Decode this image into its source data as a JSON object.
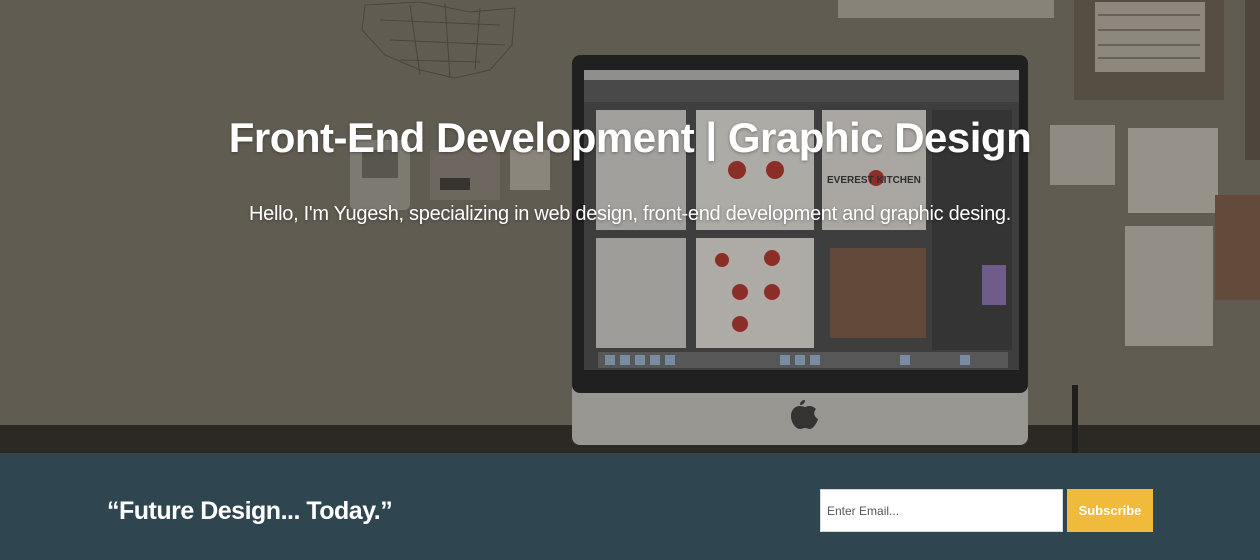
{
  "hero": {
    "title": "Front-End Development | Graphic Design",
    "subtitle": "Hello, I'm Yugesh, specializing in web design, front-end development and graphic desing.",
    "background_image": {
      "description_icon": "desk-with-imac-photo",
      "monitor_brand_text": "EVEREST KITCHEN"
    }
  },
  "cta": {
    "tagline": "“Future Design... Today.”",
    "email_placeholder": "Enter Email...",
    "subscribe_label": "Subscribe"
  },
  "colors": {
    "bar_background": "#2f4550",
    "subscribe_button": "#f0bb3a",
    "text": "#ffffff"
  }
}
